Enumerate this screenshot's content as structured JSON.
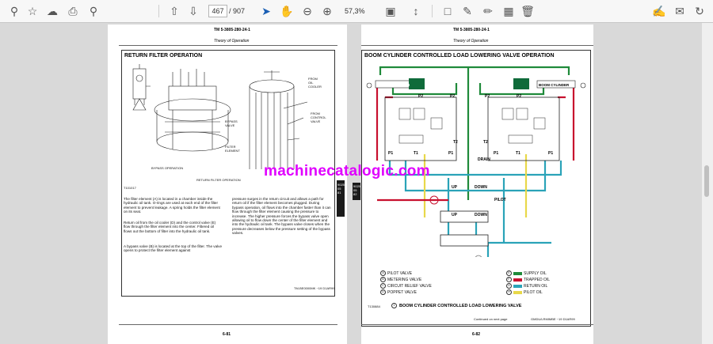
{
  "toolbar": {
    "page_current": "467",
    "page_total": "/ 907",
    "zoom": "57,3%"
  },
  "watermark": "machinecatalogic.com",
  "left_page": {
    "doc_id": "TM 5-3805-280-24-1",
    "section": "Theory of Operation",
    "title": "RETURN FILTER OPERATION",
    "labels": {
      "from_oil_cooler": "FROM\nOIL\nCOOLER",
      "bypass_valve": "BYPASS\nVALVE",
      "from_control_valve": "FROM\nCONTROL\nVALVE",
      "filter_element": "FILTER\nELEMENT",
      "caption_b": "BYPASS OPERATION",
      "caption_c": "RETURN FILTER OPERATION",
      "fig_code": "T101017"
    },
    "para1": "The filter element (A) is located in a chamber inside the hydraulic oil tank. O-rings are used at each end of the filter element to prevent leakage. A spring holds the filter element on its seat.",
    "para2": "Return oil from the oil cooler (D) and the control valve (E) flow through the filter element into the center. Filtered oil flows out the bottom of filter into the hydraulic oil tank.",
    "para3": "A bypass valve (B) is located at the top of the filter. The valve opens to protect the filter element against",
    "para4": "pressure surges in the return circuit and allows a path for return oil if the filter element becomes plugged. During bypass operation, oil flows into the chamber faster than it can flow through the filter element causing the pressure to increase. The higher pressure forces the bypass valve open allowing oil to flow down the center of the filter element and into the hydraulic oil tank. The bypass valve closes when the pressure decreases below the pressure setting of the bypass valves.",
    "footer_code": "TM-BE0000MK  ~19 D1AR99",
    "page_number": "6-81",
    "tab_text": "9025\n05\n81"
  },
  "right_page": {
    "doc_id": "TM 5-3805-280-24-1",
    "section": "Theory of Operation",
    "title": "BOOM CYLINDER CONTROLLED LOAD LOWERING VALVE OPERATION",
    "boom_left": "BOOM CYLINDER",
    "boom_right": "BOOM CYLINDER",
    "ports": [
      "P2",
      "P2",
      "P2",
      "P2",
      "P1",
      "T1",
      "P1",
      "T2",
      "T2",
      "T1",
      "P1",
      "P1"
    ],
    "drain": "DRAIN",
    "up1": "UP",
    "down1": "DOWN",
    "pilot": "PILOT",
    "up2": "UP",
    "down2": "DOWN",
    "legend_left": [
      {
        "key": "A",
        "text": "PILOT VALVE"
      },
      {
        "key": "B",
        "text": "METERING VALVE"
      },
      {
        "key": "C",
        "text": "CIRCUIT RELIEF VALVE"
      },
      {
        "key": "D",
        "text": "POPPET VALVE"
      }
    ],
    "legend_right": [
      {
        "key": "E",
        "text": "SUPPLY OIL",
        "color": "#1f8a3a"
      },
      {
        "key": "F",
        "text": "TRAPPED OIL",
        "color": "#c8102e"
      },
      {
        "key": "G",
        "text": "RETURN OIL",
        "color": "#2aa3b8"
      },
      {
        "key": "H",
        "text": "PILOT OIL",
        "color": "#e8d84a"
      }
    ],
    "fig_code": "T130884",
    "fig_caption": "BOOM CYLINDER CONTROLLED LOAD LOWERING VALVE",
    "continued": "Continued on next page",
    "footer_code": "GMDU/LRMIMBE ~19 D1AR99",
    "page_number": "6-82",
    "tab_text": "9025\n05\n82"
  },
  "colors": {
    "supply": "#1f8a3a",
    "trapped": "#c8102e",
    "return": "#2aa3b8",
    "pilot": "#e8d84a",
    "boom_bar": "#0f6b3a"
  }
}
